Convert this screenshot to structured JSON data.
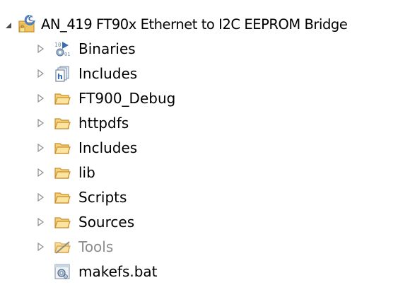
{
  "project": {
    "label": "AN_419 FT90x Ethernet to I2C EEPROM Bridge",
    "expanded": true,
    "icon": "c-project-icon"
  },
  "items": [
    {
      "label": "Binaries",
      "icon": "binaries-icon",
      "expandable": true,
      "disabled": false
    },
    {
      "label": "Includes",
      "icon": "includes-library-icon",
      "expandable": true,
      "disabled": false
    },
    {
      "label": "FT900_Debug",
      "icon": "folder-icon",
      "expandable": true,
      "disabled": false
    },
    {
      "label": "httpdfs",
      "icon": "folder-icon",
      "expandable": true,
      "disabled": false
    },
    {
      "label": "Includes",
      "icon": "folder-icon",
      "expandable": true,
      "disabled": false
    },
    {
      "label": "lib",
      "icon": "folder-icon",
      "expandable": true,
      "disabled": false
    },
    {
      "label": "Scripts",
      "icon": "folder-icon",
      "expandable": true,
      "disabled": false
    },
    {
      "label": "Sources",
      "icon": "folder-icon",
      "expandable": true,
      "disabled": false
    },
    {
      "label": "Tools",
      "icon": "excluded-folder-icon",
      "expandable": true,
      "disabled": true
    },
    {
      "label": "makefs.bat",
      "icon": "batch-file-icon",
      "expandable": false,
      "disabled": false
    }
  ],
  "colors": {
    "folder": "#f2c564",
    "folder_dark": "#c98f2c",
    "disabled_text": "#8c8c8c",
    "arrow": "#8f8f8f"
  }
}
